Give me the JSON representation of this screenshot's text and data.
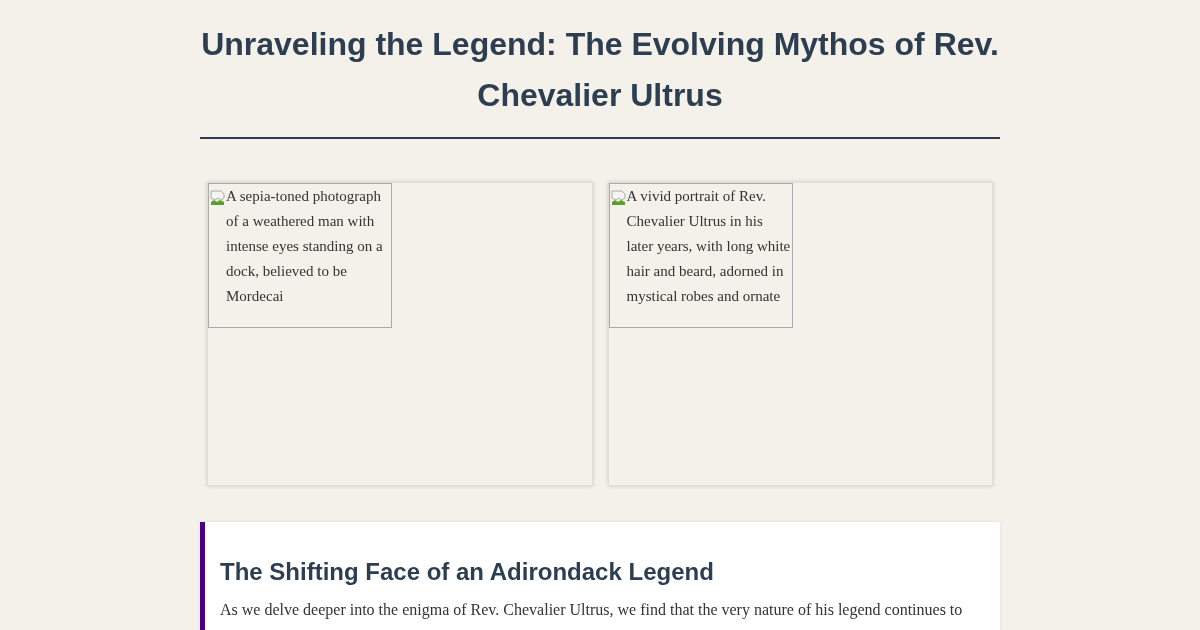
{
  "title": "Unraveling the Legend: The Evolving Mythos of Rev. Chevalier Ultrus",
  "gallery": [
    {
      "kind": "broken-image",
      "alt": "A sepia-toned photograph of a weathered man with intense eyes standing on a dock, believed to be Mordecai"
    },
    {
      "kind": "broken-image",
      "alt": "A vivid portrait of Rev. Chevalier Ultrus in his later years, with long white hair and beard, adorned in mystical robes and ornate"
    }
  ],
  "section": {
    "heading": "The Shifting Face of an Adirondack Legend",
    "paragraph": "As we delve deeper into the enigma of Rev. Chevalier Ultrus, we find that the very nature of his legend continues to"
  }
}
